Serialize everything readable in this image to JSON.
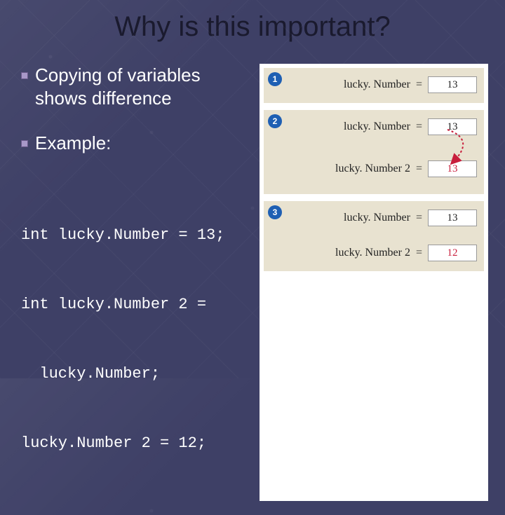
{
  "title": "Why is this important?",
  "bullets": {
    "item1": "Copying of variables shows difference",
    "item2": "Example:"
  },
  "code": {
    "line1": "int lucky.Number = 13;",
    "line2": "int lucky.Number 2 =",
    "line3": "  lucky.Number;",
    "line4": "lucky.Number 2 = 12;"
  },
  "diagram": {
    "step1": {
      "badge": "1",
      "rows": [
        {
          "name": "lucky. Number",
          "value": "13",
          "red": false
        }
      ]
    },
    "step2": {
      "badge": "2",
      "rows": [
        {
          "name": "lucky. Number",
          "value": "13",
          "red": false
        },
        {
          "name": "lucky. Number 2",
          "value": "13",
          "red": true
        }
      ]
    },
    "step3": {
      "badge": "3",
      "rows": [
        {
          "name": "lucky. Number",
          "value": "13",
          "red": false
        },
        {
          "name": "lucky. Number 2",
          "value": "12",
          "red": true
        }
      ]
    }
  }
}
